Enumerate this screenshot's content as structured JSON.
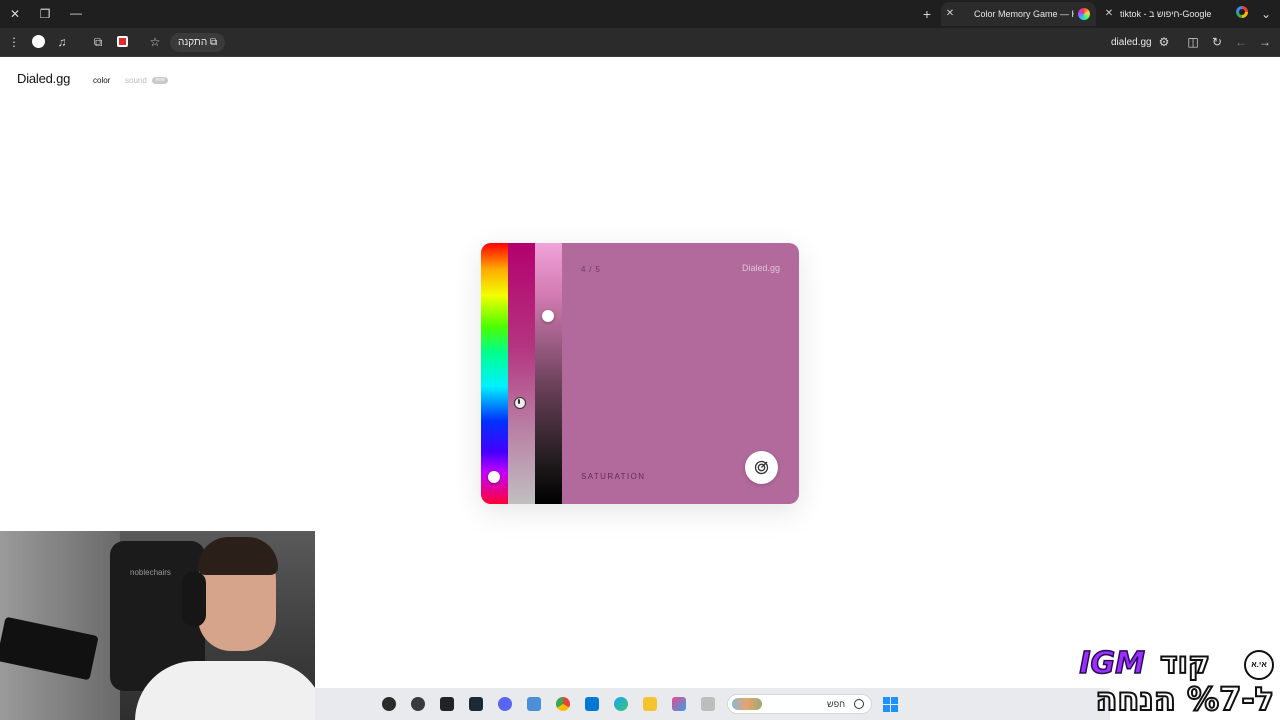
{
  "browser": {
    "tabs": [
      {
        "title": "Color Memory Game — Ho",
        "active": true
      },
      {
        "title": "tiktok - חיפוש ב-Google",
        "active": false
      }
    ],
    "install_chip": "התקנה",
    "url": "dialed.gg"
  },
  "site": {
    "logo": "Dialed.gg",
    "nav": {
      "color": "color",
      "sound": "sound",
      "sound_badge": "new"
    }
  },
  "game": {
    "round": "4 / 5",
    "brand": "Dialed.gg",
    "parameter_label": "SATURATION",
    "current_color": "#b26a9c"
  },
  "webcam": {
    "chair_brand": "noblechairs"
  },
  "taskbar": {
    "search_placeholder": "חפש"
  },
  "promo": {
    "code_word": "קוד",
    "code": "IGM",
    "logo": "אי.א",
    "discount": "ל-%7 הנחה"
  }
}
